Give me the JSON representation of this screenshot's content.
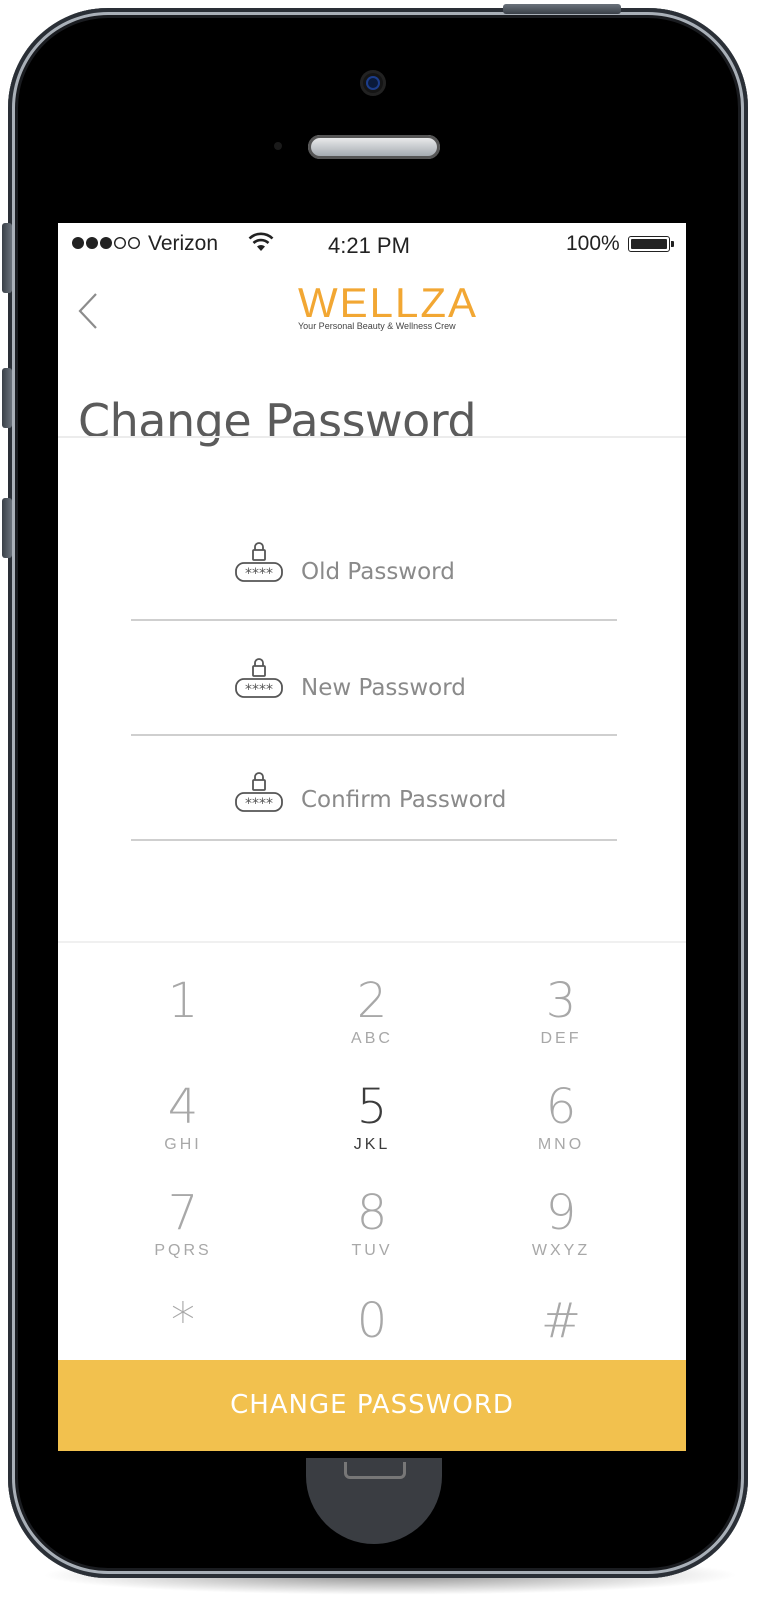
{
  "status_bar": {
    "carrier": "Verizon",
    "time": "4:21 PM",
    "battery": "100%"
  },
  "header": {
    "logo_text": "WELLZA",
    "logo_tagline": "Your Personal Beauty & Wellness Crew",
    "title": "Change Password"
  },
  "form": {
    "old_password_placeholder": "Old Password",
    "new_password_placeholder": "New Password",
    "confirm_password_placeholder": "Confirm Password"
  },
  "keypad": {
    "keys": [
      {
        "digit": "1",
        "letters": ""
      },
      {
        "digit": "2",
        "letters": "ABC"
      },
      {
        "digit": "3",
        "letters": "DEF"
      },
      {
        "digit": "4",
        "letters": "GHI"
      },
      {
        "digit": "5",
        "letters": "JKL"
      },
      {
        "digit": "6",
        "letters": "MNO"
      },
      {
        "digit": "7",
        "letters": "PQRS"
      },
      {
        "digit": "8",
        "letters": "TUV"
      },
      {
        "digit": "9",
        "letters": "WXYZ"
      },
      {
        "digit": "*",
        "letters": ""
      },
      {
        "digit": "0",
        "letters": ""
      },
      {
        "digit": "#",
        "letters": ""
      }
    ]
  },
  "action": {
    "change_password_label": "CHANGE PASSWORD"
  },
  "colors": {
    "accent": "#f2c14e",
    "logo": "#f2a733"
  }
}
